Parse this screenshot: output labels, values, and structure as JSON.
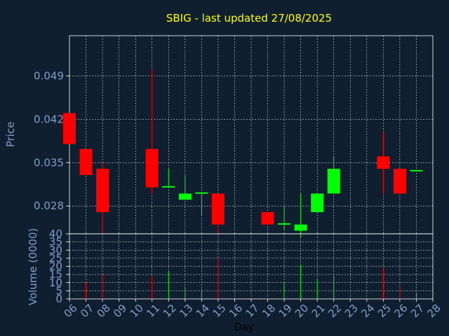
{
  "chart_data": {
    "type": "candlestick",
    "title": "SBIG - last updated 27/08/2025",
    "xlabel": "Day",
    "x_ticks": [
      "06",
      "07",
      "08",
      "09",
      "10",
      "11",
      "12",
      "13",
      "14",
      "15",
      "16",
      "17",
      "18",
      "19",
      "20",
      "21",
      "22",
      "23",
      "24",
      "25",
      "26",
      "27",
      "28"
    ],
    "price_panel": {
      "ylabel": "Price",
      "ylim": [
        0.0235,
        0.0555
      ],
      "y_ticks": [
        "0.028",
        "0.035",
        "0.042",
        "0.049"
      ],
      "y_tick_values": [
        0.028,
        0.035,
        0.042,
        0.049
      ],
      "candles": [
        {
          "day": 6,
          "open": 0.043,
          "high": 0.043,
          "low": 0.038,
          "close": 0.038
        },
        {
          "day": 7,
          "open": 0.0372,
          "high": 0.0372,
          "low": 0.033,
          "close": 0.033
        },
        {
          "day": 8,
          "open": 0.034,
          "high": 0.035,
          "low": 0.0235,
          "close": 0.027
        },
        {
          "day": 11,
          "open": 0.0372,
          "high": 0.05,
          "low": 0.03,
          "close": 0.031
        },
        {
          "day": 12,
          "open": 0.031,
          "high": 0.034,
          "low": 0.031,
          "close": 0.0312
        },
        {
          "day": 13,
          "open": 0.029,
          "high": 0.033,
          "low": 0.029,
          "close": 0.03
        },
        {
          "day": 14,
          "open": 0.03,
          "high": 0.03,
          "low": 0.0265,
          "close": 0.0302
        },
        {
          "day": 15,
          "open": 0.03,
          "high": 0.03,
          "low": 0.0235,
          "close": 0.025
        },
        {
          "day": 18,
          "open": 0.027,
          "high": 0.027,
          "low": 0.025,
          "close": 0.025
        },
        {
          "day": 19,
          "open": 0.025,
          "high": 0.028,
          "low": 0.024,
          "close": 0.0252
        },
        {
          "day": 20,
          "open": 0.024,
          "high": 0.03,
          "low": 0.023,
          "close": 0.025
        },
        {
          "day": 21,
          "open": 0.027,
          "high": 0.03,
          "low": 0.027,
          "close": 0.03
        },
        {
          "day": 22,
          "open": 0.03,
          "high": 0.036,
          "low": 0.03,
          "close": 0.034
        },
        {
          "day": 25,
          "open": 0.036,
          "high": 0.04,
          "low": 0.03,
          "close": 0.034
        },
        {
          "day": 26,
          "open": 0.034,
          "high": 0.034,
          "low": 0.03,
          "close": 0.03
        },
        {
          "day": 27,
          "open": 0.0338,
          "high": 0.0338,
          "low": 0.0336,
          "close": 0.0338
        }
      ]
    },
    "volume_panel": {
      "ylabel": "Volume (0000)",
      "ylim": [
        0,
        40
      ],
      "y_ticks": [
        "0",
        "5",
        "10",
        "15",
        "20",
        "25",
        "30",
        "35",
        "40"
      ],
      "y_tick_values": [
        0,
        5,
        10,
        15,
        20,
        25,
        30,
        35,
        40
      ],
      "bars": [
        {
          "day": 7,
          "value": 10,
          "direction": "down"
        },
        {
          "day": 8,
          "value": 15,
          "direction": "down"
        },
        {
          "day": 11,
          "value": 14,
          "direction": "down"
        },
        {
          "day": 12,
          "value": 17,
          "direction": "up"
        },
        {
          "day": 13,
          "value": 7,
          "direction": "up"
        },
        {
          "day": 14,
          "value": 6,
          "direction": "up"
        },
        {
          "day": 15,
          "value": 25,
          "direction": "down"
        },
        {
          "day": 18,
          "value": 9,
          "direction": "down"
        },
        {
          "day": 19,
          "value": 10,
          "direction": "up"
        },
        {
          "day": 20,
          "value": 21,
          "direction": "up"
        },
        {
          "day": 21,
          "value": 12,
          "direction": "up"
        },
        {
          "day": 22,
          "value": 14,
          "direction": "up"
        },
        {
          "day": 25,
          "value": 19,
          "direction": "down"
        },
        {
          "day": 26,
          "value": 8,
          "direction": "down"
        },
        {
          "day": 27,
          "value": 4,
          "direction": "up"
        }
      ]
    },
    "grid": true,
    "colors": {
      "background": "#0f1f30",
      "axis": "#ffffff",
      "grid": "#ffffff",
      "title": "#ffff00",
      "tick_label": "#7f9fc8",
      "axis_label": "#7f9fc8",
      "xlabel": "#000000",
      "up": "#00ff00",
      "down": "#ff0000"
    }
  }
}
